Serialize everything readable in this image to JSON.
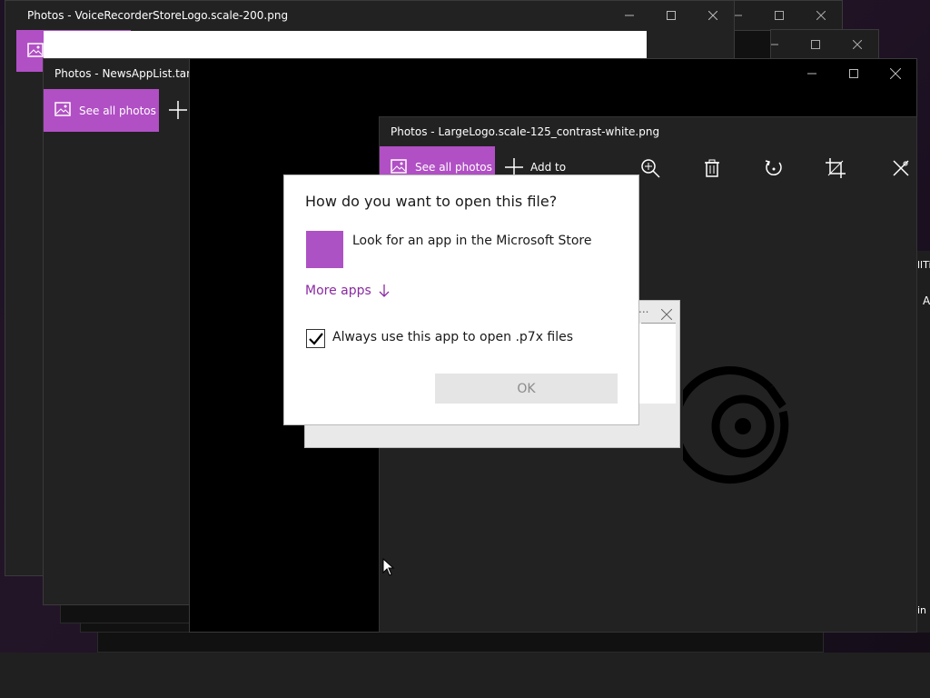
{
  "windows": {
    "back": {
      "title": "Photos - VoiceRecorderStoreLogo.scale-200.png"
    },
    "middle": {
      "title": "Photos - NewsAppList.targe",
      "see_all_label": "See all photos"
    },
    "front": {
      "title": "Photos - LargeLogo.scale-125_contrast-white.png",
      "see_all_label": "See all photos",
      "add_to_label": "Add to"
    }
  },
  "edge_fragments": {
    "right_top": "llTi",
    "right_mid": "A",
    "right_bottom": "in"
  },
  "dialog": {
    "heading": "How do you want to open this file?",
    "store_option": "Look for an app in the Microsoft Store",
    "more_apps": "More apps",
    "always_use": "Always use this app to open .p7x files",
    "always_use_checked": true,
    "ok_label": "OK",
    "accent_color": "#ad52c4",
    "link_color": "#8b2aa3"
  },
  "mini_window": {
    "ellipsis": "..."
  },
  "colors": {
    "photos_accent": "#b14fc5",
    "window_dark": "#222222",
    "canvas_black": "#000000"
  },
  "icons": {
    "zoom": "zoom-in-icon",
    "delete": "trash-icon",
    "rotate": "rotate-icon",
    "crop": "crop-icon",
    "edit": "edit-draw-icon"
  }
}
